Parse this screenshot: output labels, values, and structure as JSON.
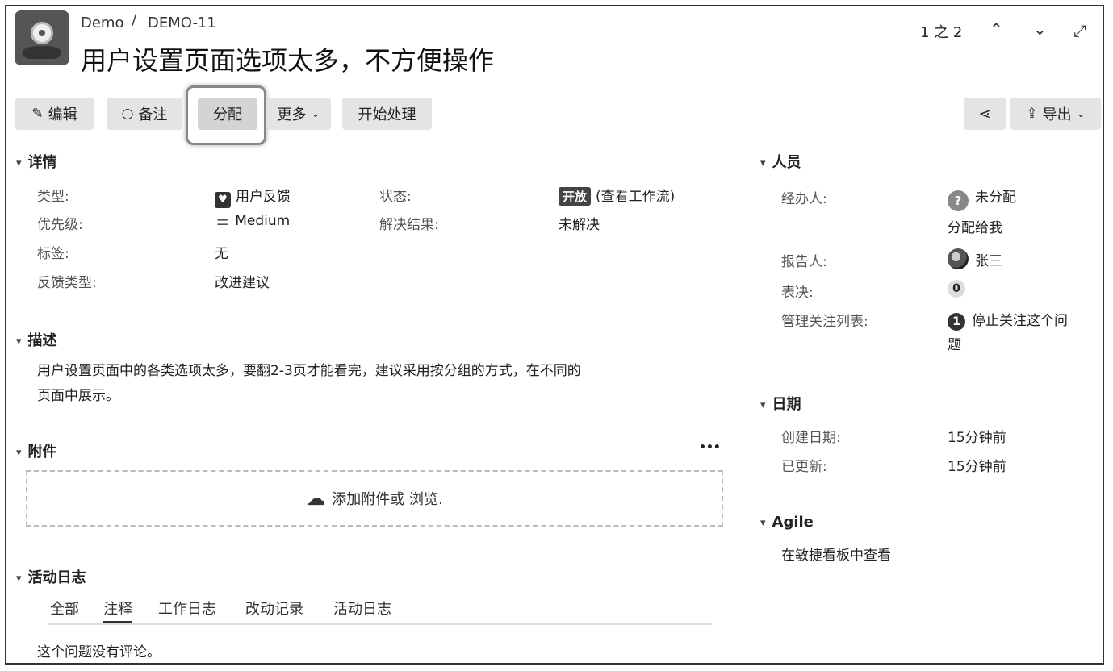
{
  "header": {
    "project": "Demo",
    "separator": "/",
    "issue_key": "DEMO-11",
    "title": "用户设置页面选项太多，不方便操作",
    "pager": "1 之 2"
  },
  "toolbar": {
    "edit": "编辑",
    "comment": "备注",
    "assign": "分配",
    "more": "更多",
    "start": "开始处理",
    "export": "导出"
  },
  "details": {
    "heading": "详情",
    "type_label": "类型:",
    "type_value": "用户反馈",
    "priority_label": "优先级:",
    "priority_value": "Medium",
    "labels_label": "标签:",
    "labels_value": "无",
    "feedback_type_label": "反馈类型:",
    "feedback_type_value": "改进建议",
    "status_label": "状态:",
    "status_badge": "开放",
    "status_workflow": "(查看工作流)",
    "resolution_label": "解决结果:",
    "resolution_value": "未解决"
  },
  "description": {
    "heading": "描述",
    "line1": "用户设置页面中的各类选项太多，要翻2-3页才能看完，建议采用按分组的方式，在不同的",
    "line2": "页面中展示。"
  },
  "attachments": {
    "heading": "附件",
    "more": "•••",
    "drop_text": "添加附件或 浏览."
  },
  "activity": {
    "heading": "活动日志",
    "tabs": [
      "全部",
      "注释",
      "工作日志",
      "改动记录",
      "活动日志"
    ],
    "active_tab": "注释",
    "empty": "这个问题没有评论。"
  },
  "people": {
    "heading": "人员",
    "assignee_label": "经办人:",
    "assignee_value": "未分配",
    "assign_to_me": "分配给我",
    "reporter_label": "报告人:",
    "reporter_value": "张三",
    "votes_label": "表决:",
    "votes_count": "0",
    "watchers_label": "管理关注列表:",
    "watchers_count": "1",
    "watch_line1": "停止关注这个问",
    "watch_line2": "题"
  },
  "dates": {
    "heading": "日期",
    "created_label": "创建日期:",
    "created_value": "15分钟前",
    "updated_label": "已更新:",
    "updated_value": "15分钟前"
  },
  "agile": {
    "heading": "Agile",
    "link": "在敏捷看板中查看"
  },
  "colors": {
    "button_bg": "#e4e4e4",
    "badge_dark": "#444444"
  }
}
